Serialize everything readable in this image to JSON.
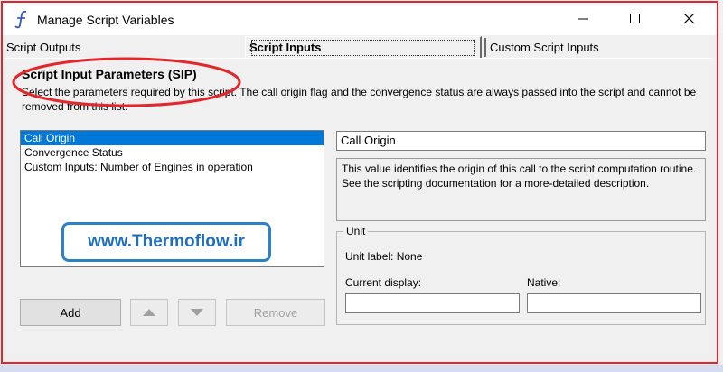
{
  "window": {
    "title": "Manage Script Variables",
    "controls": [
      "minimize-icon",
      "maximize-icon",
      "close-icon"
    ]
  },
  "tabs": [
    {
      "label": "Script Outputs",
      "selected": false
    },
    {
      "label": "Script Inputs",
      "selected": true
    },
    {
      "label": "Custom Script Inputs",
      "selected": false
    }
  ],
  "section": {
    "heading": "Script Input Parameters (SIP)",
    "description": "Select the parameters required by this script.  The call origin flag and the convergence status are always passed into the script and cannot be removed from this list."
  },
  "list": {
    "items": [
      "Call Origin",
      "Convergence Status",
      "Custom Inputs: Number of Engines in operation"
    ],
    "selected_index": 0
  },
  "watermark": "www.Thermoflow.ir",
  "buttons": {
    "add": "Add",
    "move_up": "up-arrow-icon",
    "move_down": "down-arrow-icon",
    "remove": "Remove"
  },
  "detail": {
    "name": "Call Origin",
    "description": "This value identifies the origin of this call to the script computation routine.\nSee the scripting documentation for a more-detailed description."
  },
  "unit": {
    "legend": "Unit",
    "unit_label": "Unit label: None",
    "current_display_label": "Current display:",
    "current_display_value": "",
    "native_label": "Native:",
    "native_value": ""
  },
  "colors": {
    "annotation_red": "#e3262b",
    "selection_blue": "#0078d7",
    "watermark_blue": "#1f6fbf"
  }
}
